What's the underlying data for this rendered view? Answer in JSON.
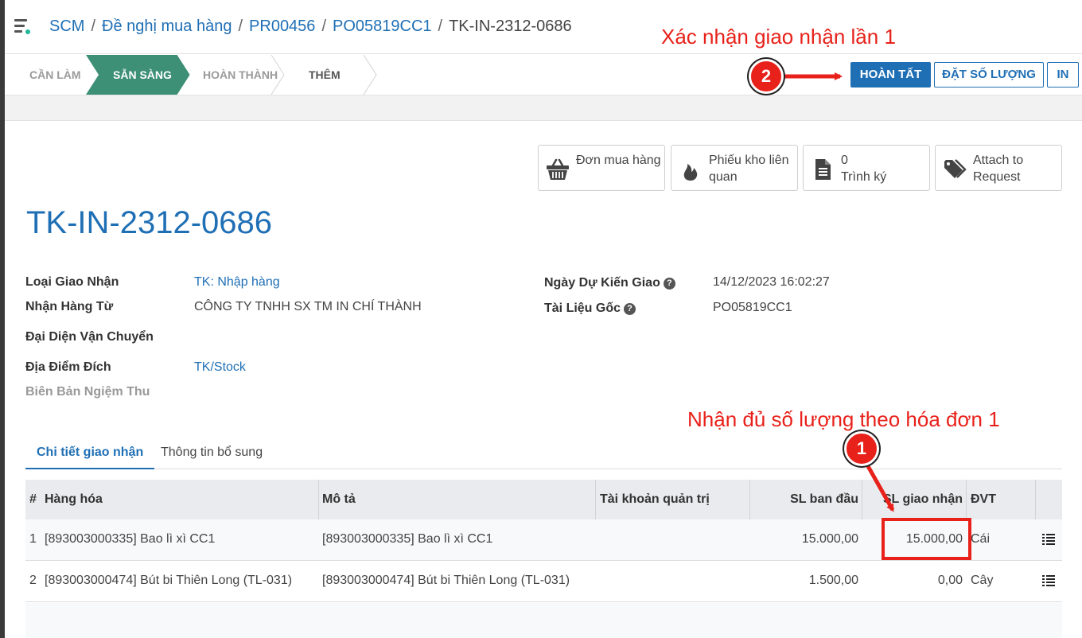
{
  "breadcrumb": {
    "items": [
      "SCM",
      "Đề nghị mua hàng",
      "PR00456",
      "PO05819CC1"
    ],
    "current": "TK-IN-2312-0686"
  },
  "statusbar": {
    "stages": [
      "CẦN LÀM",
      "SẴN SÀNG",
      "HOÀN THÀNH",
      "THÊM"
    ],
    "active_stage": "SẴN SÀNG",
    "buttons": {
      "done": "HOÀN TẤT",
      "set_qty": "ĐẶT SỐ LƯỢNG",
      "print": "IN"
    }
  },
  "smart_buttons": [
    {
      "label": "Đơn mua hàng",
      "icon": "basket-icon"
    },
    {
      "label": "Phiếu kho liên quan",
      "icon": "fire-icon"
    },
    {
      "count": "0",
      "label": "Trình ký",
      "icon": "document-icon"
    },
    {
      "label": "Attach to Request",
      "icon": "tags-icon"
    }
  ],
  "record": {
    "title": "TK-IN-2312-0686",
    "fields_left": {
      "picking_type_label": "Loại Giao Nhận",
      "picking_type": "TK: Nhập hàng",
      "partner_label": "Nhận Hàng Từ",
      "partner": "CÔNG TY TNHH SX TM IN CHÍ THÀNH",
      "carrier_label": "Đại Diện Vận Chuyển",
      "dest_label": "Địa Điểm Đích",
      "dest": "TK/Stock",
      "acceptance_label": "Biên Bản Ngiệm Thu"
    },
    "fields_right": {
      "scheduled_label": "Ngày Dự Kiến Giao",
      "scheduled": "14/12/2023 16:02:27",
      "origin_label": "Tài Liệu Gốc",
      "origin": "PO05819CC1"
    }
  },
  "tabs": [
    "Chi tiết giao nhận",
    "Thông tin bổ sung"
  ],
  "table": {
    "headers": [
      "#",
      "Hàng hóa",
      "Mô tả",
      "Tài khoản quản trị",
      "SL ban đầu",
      "SL giao nhận",
      "ĐVT"
    ],
    "rows": [
      {
        "no": "1",
        "product": "[893003000335] Bao lì xì CC1",
        "desc": "[893003000335] Bao lì xì CC1",
        "account": "",
        "initial": "15.000,00",
        "received": "15.000,00",
        "uom": "Cái"
      },
      {
        "no": "2",
        "product": "[893003000474] Bút bi Thiên Long (TL-031)",
        "desc": "[893003000474] Bút bi Thiên Long (TL-031)",
        "account": "",
        "initial": "1.500,00",
        "received": "0,00",
        "uom": "Cây"
      }
    ]
  },
  "annotations": {
    "step1_text": "Nhận đủ số lượng theo hóa đơn 1",
    "step1_badge": "1",
    "step2_text": "Xác nhận giao nhận lần 1",
    "step2_badge": "2",
    "color": "#e8211a"
  },
  "colors": {
    "primary": "#1f6fb5",
    "active_stage": "#3d8f76",
    "annotation": "#e8211a"
  }
}
